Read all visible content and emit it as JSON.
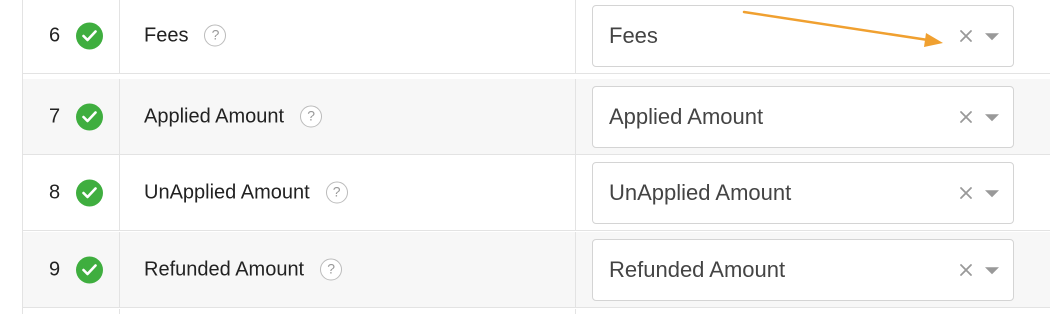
{
  "rows": [
    {
      "number": "6",
      "name": "Fees",
      "help": "?",
      "selected": "Fees"
    },
    {
      "number": "7",
      "name": "Applied Amount",
      "help": "?",
      "selected": "Applied Amount"
    },
    {
      "number": "8",
      "name": "UnApplied Amount",
      "help": "?",
      "selected": "UnApplied Amount"
    },
    {
      "number": "9",
      "name": "Refunded Amount",
      "help": "?",
      "selected": "Refunded Amount"
    }
  ],
  "icons": {
    "status": "check-circle-icon",
    "help": "question-mark-icon",
    "clear": "close-icon",
    "dropdown": "chevron-down-icon",
    "annotation": "arrow-annotation"
  },
  "colors": {
    "check_green": "#3fae3f",
    "annotation_orange": "#f0a030",
    "alt_row": "#f7f7f7"
  }
}
